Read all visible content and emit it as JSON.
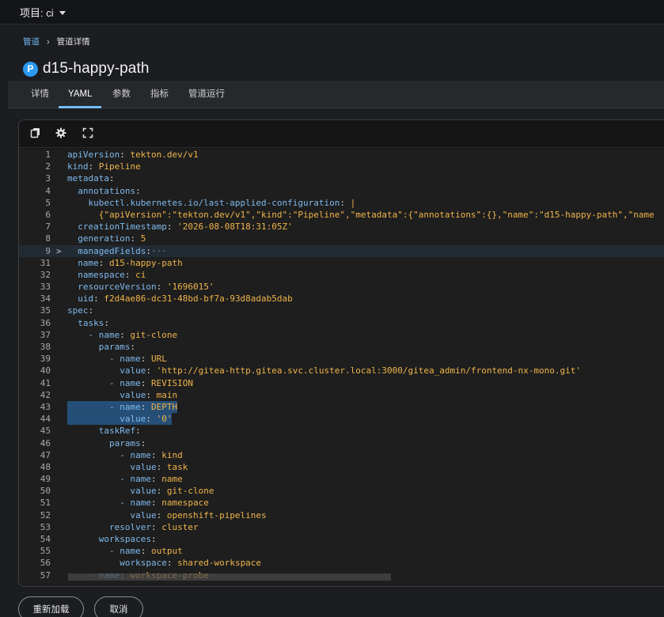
{
  "header": {
    "project_label": "项目: ci"
  },
  "breadcrumb": {
    "parent": "管道",
    "current": "管道详情"
  },
  "page": {
    "badge": "P",
    "title": "d15-happy-path"
  },
  "tabs": [
    {
      "label": "详情"
    },
    {
      "label": "YAML",
      "active": true
    },
    {
      "label": "参数"
    },
    {
      "label": "指标"
    },
    {
      "label": "管道运行"
    }
  ],
  "toolbar": {
    "icons": [
      "copy-icon",
      "gear-icon",
      "expand-icon"
    ]
  },
  "editor": {
    "folded_marker": "···",
    "lines": [
      {
        "n": "1",
        "k": "apiVersion",
        "v": "tekton.dev/v1"
      },
      {
        "n": "2",
        "k": "kind",
        "v": "Pipeline"
      },
      {
        "n": "3",
        "k": "metadata",
        "v": ""
      },
      {
        "n": "4",
        "k": "  annotations",
        "v": ""
      },
      {
        "n": "5",
        "k": "    kubectl.kubernetes.io/last-applied-configuration",
        "v": "|"
      },
      {
        "n": "6",
        "k": "",
        "v": "      {\"apiVersion\":\"tekton.dev/v1\",\"kind\":\"Pipeline\",\"metadata\":{\"annotations\":{},\"name\":\"d15-happy-path\",\"name"
      },
      {
        "n": "7",
        "k": "  creationTimestamp",
        "v": "'2026-08-08T18:31:05Z'"
      },
      {
        "n": "8",
        "k": "  generation",
        "v": "5"
      },
      {
        "n": "9",
        "k": "  managedFields",
        "v": "",
        "folded": true
      },
      {
        "n": "31",
        "k": "  name",
        "v": "d15-happy-path"
      },
      {
        "n": "32",
        "k": "  namespace",
        "v": "ci"
      },
      {
        "n": "33",
        "k": "  resourceVersion",
        "v": "'1696015'"
      },
      {
        "n": "34",
        "k": "  uid",
        "v": "f2d4ae86-dc31-48bd-bf7a-93d8adab5dab"
      },
      {
        "n": "35",
        "k": "spec",
        "v": ""
      },
      {
        "n": "36",
        "k": "  tasks",
        "v": ""
      },
      {
        "n": "37",
        "k": "    - name",
        "v": "git-clone"
      },
      {
        "n": "38",
        "k": "      params",
        "v": ""
      },
      {
        "n": "39",
        "k": "        - name",
        "v": "URL"
      },
      {
        "n": "40",
        "k": "          value",
        "v": "'http://gitea-http.gitea.svc.cluster.local:3000/gitea_admin/frontend-nx-mono.git'"
      },
      {
        "n": "41",
        "k": "        - name",
        "v": "REVISION"
      },
      {
        "n": "42",
        "k": "          value",
        "v": "main"
      },
      {
        "n": "43",
        "k": "        - name",
        "v": "DEPTH",
        "selected": true
      },
      {
        "n": "44",
        "k": "          value",
        "v": "'0'",
        "selected": true
      },
      {
        "n": "45",
        "k": "      taskRef",
        "v": ""
      },
      {
        "n": "46",
        "k": "        params",
        "v": ""
      },
      {
        "n": "47",
        "k": "          - name",
        "v": "kind"
      },
      {
        "n": "48",
        "k": "            value",
        "v": "task"
      },
      {
        "n": "49",
        "k": "          - name",
        "v": "name"
      },
      {
        "n": "50",
        "k": "            value",
        "v": "git-clone"
      },
      {
        "n": "51",
        "k": "          - name",
        "v": "namespace"
      },
      {
        "n": "52",
        "k": "            value",
        "v": "openshift-pipelines"
      },
      {
        "n": "53",
        "k": "        resolver",
        "v": "cluster"
      },
      {
        "n": "54",
        "k": "      workspaces",
        "v": ""
      },
      {
        "n": "55",
        "k": "        - name",
        "v": "output"
      },
      {
        "n": "56",
        "k": "          workspace",
        "v": "shared-workspace"
      },
      {
        "n": "57",
        "k": "    - name",
        "v": "workspace-probe"
      }
    ]
  },
  "actions": {
    "reload": "重新加载",
    "cancel": "取消"
  }
}
